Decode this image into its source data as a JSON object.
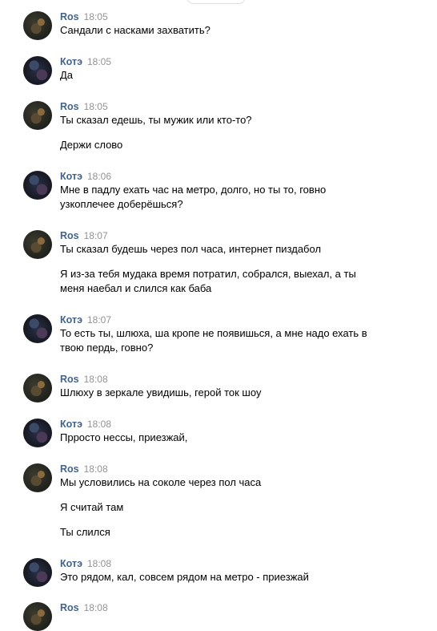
{
  "messages": [
    {
      "author": "Ros",
      "time": "18:05",
      "lines": [
        "Сандали с насками захватить?"
      ]
    },
    {
      "author": "Котэ",
      "time": "18:05",
      "lines": [
        "Да"
      ]
    },
    {
      "author": "Ros",
      "time": "18:05",
      "lines": [
        "Ты сказал едешь, ты мужик или кто-то?",
        "Держи слово"
      ]
    },
    {
      "author": "Котэ",
      "time": "18:06",
      "lines": [
        "Мне в падлу ехать час на метро, долго, но ты то, говно узкоплечее доберёшься?"
      ]
    },
    {
      "author": "Ros",
      "time": "18:07",
      "lines": [
        "Ты сказал будешь через пол часа, интернет пиздабол",
        "Я из-за тебя мудака время потратил, собрался, выехал, а ты меня наебал и слился как баба"
      ]
    },
    {
      "author": "Котэ",
      "time": "18:07",
      "lines": [
        "То есть ты, шлюха, ша кропе не появишься, а мне надо ехать в твою пердь, говно?"
      ]
    },
    {
      "author": "Ros",
      "time": "18:08",
      "lines": [
        "Шлюху в зеркале увидишь, герой ток шоу"
      ]
    },
    {
      "author": "Котэ",
      "time": "18:08",
      "lines": [
        "Прросто нессы, приезжай,"
      ]
    },
    {
      "author": "Ros",
      "time": "18:08",
      "lines": [
        "Мы условились на соколе через пол часа",
        "Я считай там",
        "Ты слился"
      ]
    },
    {
      "author": "Котэ",
      "time": "18:08",
      "lines": [
        "Это рядом, кал, совсем рядом на метро - приезжай"
      ]
    },
    {
      "author": "Ros",
      "time": "18:08",
      "lines": []
    }
  ]
}
